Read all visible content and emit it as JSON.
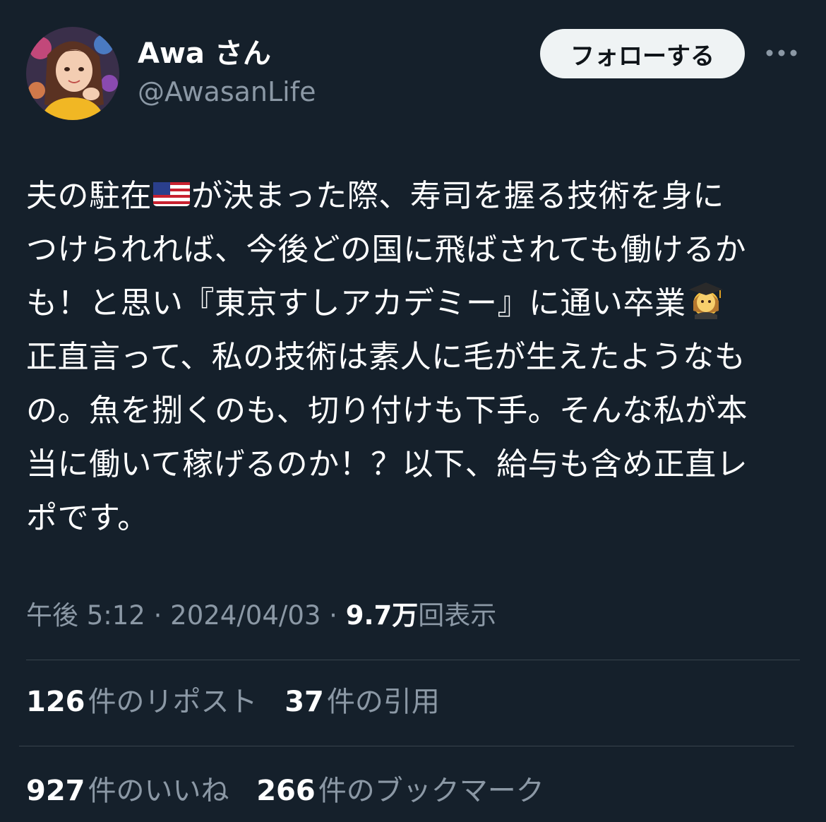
{
  "user": {
    "display_name": "Awa さん",
    "handle": "@AwasanLife",
    "avatar": "woman-portrait-avatar"
  },
  "actions": {
    "follow_label": "フォローする",
    "more_icon": "more-horizontal-icon"
  },
  "tweet": {
    "lines": [
      {
        "pre": "夫の駐在",
        "post": "が決まった際、寿司を握る技術を身に"
      },
      "つけられれば、今後どの国に飛ばされても働けるか",
      {
        "pre": "も！と思い『東京すしアカデミー』に通い卒業",
        "post": ""
      },
      "正直言って、私の技術は素人に毛が生えたようなも",
      "の。魚を捌くのも、切り付けも下手。そんな私が本",
      "当に働いて稼げるのか！？以下、給与も含め正直レ",
      "ポです。"
    ],
    "emojis": [
      "us-flag-emoji",
      "graduate-woman-emoji"
    ]
  },
  "meta": {
    "time": "午後 5:12",
    "sep1": " · ",
    "date": "2024/04/03",
    "sep2": " · ",
    "views_count": "9.7万",
    "views_label": "回表示"
  },
  "stats": {
    "reposts_count": "126",
    "reposts_label": "件のリポスト",
    "quotes_count": "37",
    "quotes_label": "件の引用",
    "likes_count": "927",
    "likes_label": "件のいいね",
    "bookmarks_count": "266",
    "bookmarks_label": "件のブックマーク"
  },
  "colors": {
    "background": "#15202b",
    "secondary_text": "#8b98a5",
    "divider": "#38444d",
    "follow_bg": "#eff3f4"
  }
}
